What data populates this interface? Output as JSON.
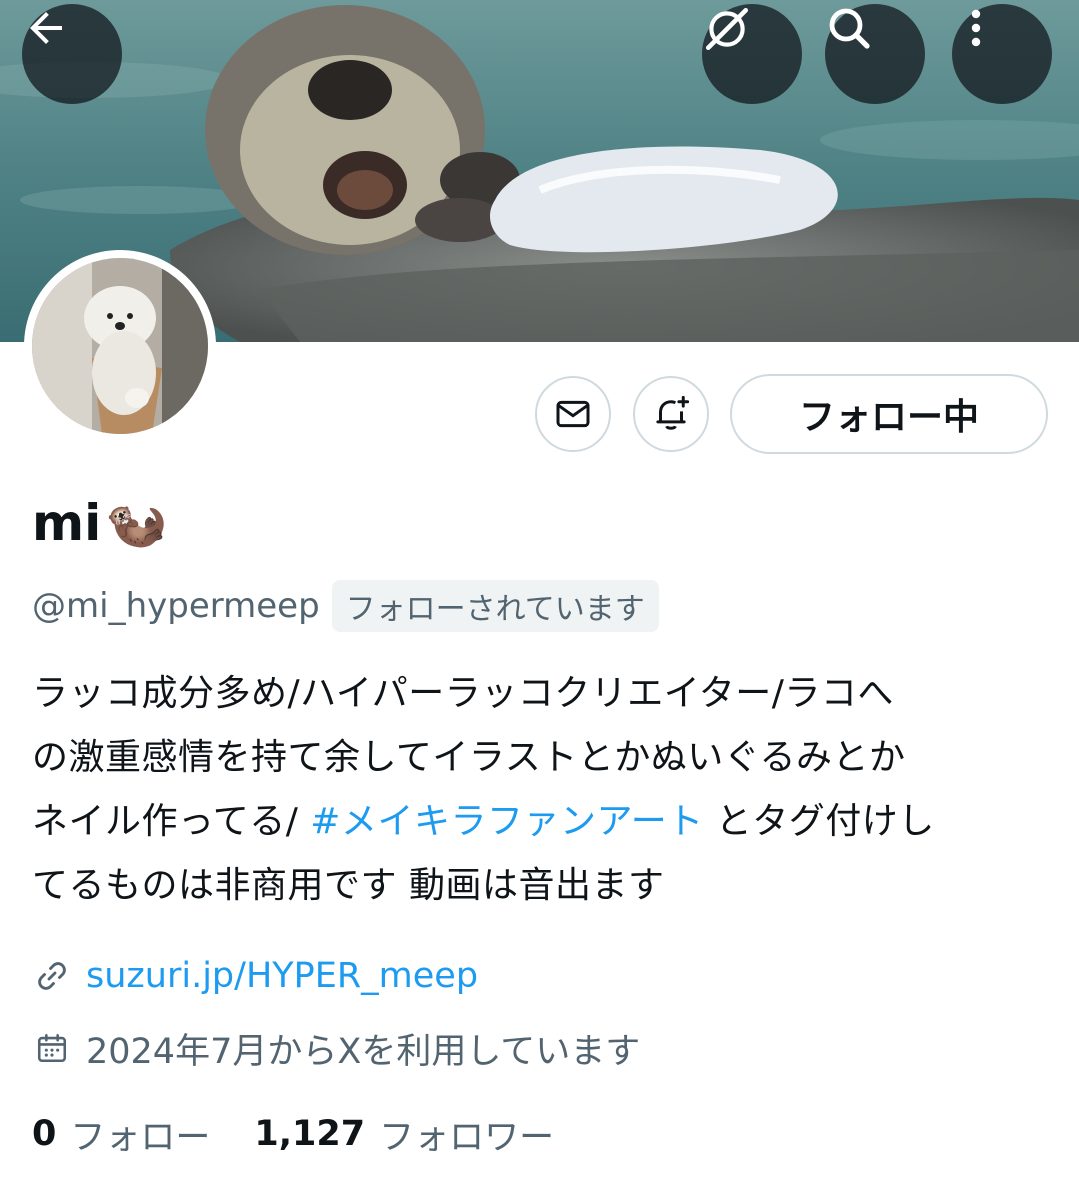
{
  "header": {
    "back_icon": "arrow-left-icon",
    "grok_icon": "grok-icon",
    "search_icon": "search-icon",
    "more_icon": "more-vertical-icon"
  },
  "profile": {
    "display_name": "mi",
    "name_emoji": "🦦",
    "handle": "@mi_hypermeep",
    "follows_you_badge": "フォローされています",
    "following_button": "フォロー中",
    "bio": {
      "line1": "ラッコ成分多め/ハイパーラッコクリエイター/ラコへ",
      "line2": "の激重感情を持て余してイラストとかぬいぐるみとか",
      "line3_before": "ネイル作ってる/ ",
      "hashtag": "#メイキラファンアート",
      "line3_after": " とタグ付けし",
      "line4": "てるものは非商用です 動画は音出ます"
    },
    "website": "suzuri.jp/HYPER_meep",
    "joined": "2024年7月からXを利用しています",
    "following_count": "0",
    "following_label": "フォロー",
    "followers_count": "1,127",
    "followers_label": "フォロワー"
  },
  "colors": {
    "accent": "#1d9bf0",
    "text_primary": "#0f1419",
    "text_secondary": "#536471",
    "border": "#cfd9de"
  }
}
